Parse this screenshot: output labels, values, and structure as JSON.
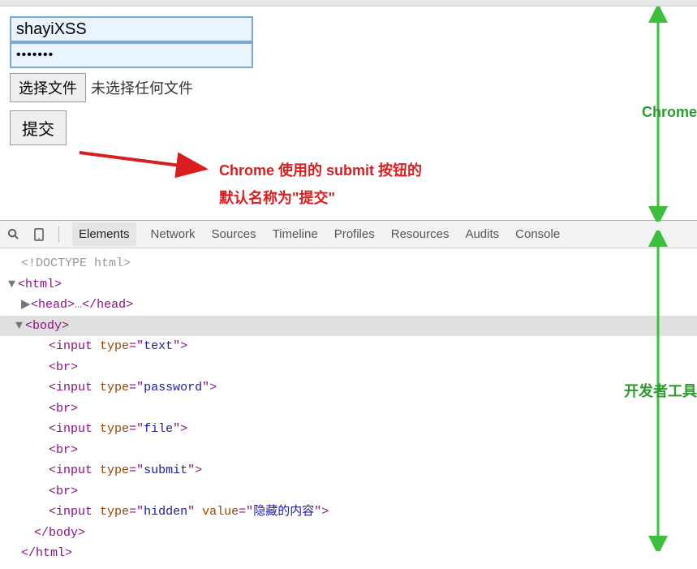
{
  "form": {
    "text_value": "shayiXSS",
    "password_value": "•••••••",
    "file_button_label": "选择文件",
    "file_status_text": "未选择任何文件",
    "submit_label": "提交"
  },
  "annotation": {
    "line1": "Chrome 使用的 submit 按钮的",
    "line2": "默认名称为\"提交\""
  },
  "devtools": {
    "tabs": [
      "Elements",
      "Network",
      "Sources",
      "Timeline",
      "Profiles",
      "Resources",
      "Audits",
      "Console"
    ],
    "active_tab": "Elements",
    "code": {
      "doctype": "<!DOCTYPE html>",
      "html_open": "<html>",
      "head": "<head>…</head>",
      "body_open": "<body>",
      "lines": [
        {
          "tag": "input",
          "attrs": [
            {
              "name": "type",
              "value": "text"
            }
          ]
        },
        {
          "tag": "br"
        },
        {
          "tag": "input",
          "attrs": [
            {
              "name": "type",
              "value": "password"
            }
          ]
        },
        {
          "tag": "br"
        },
        {
          "tag": "input",
          "attrs": [
            {
              "name": "type",
              "value": "file"
            }
          ]
        },
        {
          "tag": "br"
        },
        {
          "tag": "input",
          "attrs": [
            {
              "name": "type",
              "value": "submit"
            }
          ]
        },
        {
          "tag": "br"
        },
        {
          "tag": "input",
          "attrs": [
            {
              "name": "type",
              "value": "hidden"
            },
            {
              "name": "value",
              "value": "隐藏的内容"
            }
          ]
        }
      ],
      "body_close": "</body>",
      "html_close": "</html>"
    }
  },
  "side_labels": {
    "chrome": "Chrome",
    "devtools": "开发者工具"
  },
  "colors": {
    "annotation_red": "#d81e1e",
    "label_green": "#2e9b2e",
    "input_border": "#7aa8d4"
  }
}
